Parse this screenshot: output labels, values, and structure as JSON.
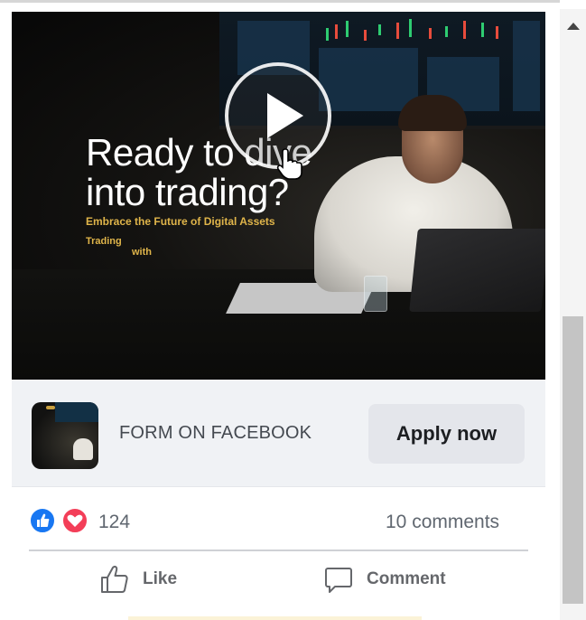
{
  "video": {
    "headline_line1": "Ready to dive",
    "headline_line2": "into trading?",
    "subline": "Embrace the Future of Digital Assets",
    "trading": "Trading",
    "with": "with"
  },
  "cta": {
    "form_label": "FORM ON FACEBOOK",
    "apply_label": "Apply now"
  },
  "stats": {
    "reaction_count": "124",
    "comments": "10 comments"
  },
  "actions": {
    "like_label": "Like",
    "comment_label": "Comment"
  },
  "icons": {
    "play": "play-icon",
    "cursor": "hand-cursor-icon",
    "like_reaction": "thumbs-up-reaction-icon",
    "love_reaction": "heart-reaction-icon",
    "like_action": "thumbs-up-icon",
    "comment_action": "comment-bubble-icon"
  },
  "colors": {
    "facebook_blue": "#1877f2",
    "love_red": "#f33e58",
    "gold_text": "#e0b54a"
  }
}
